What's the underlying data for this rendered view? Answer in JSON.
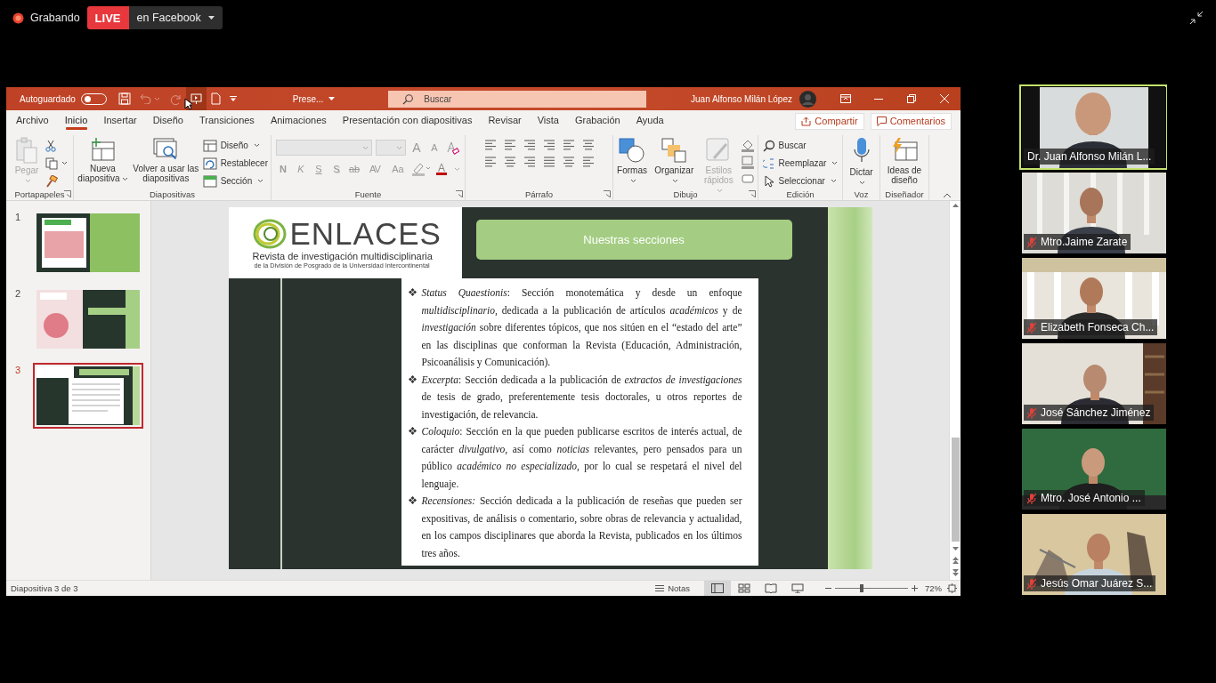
{
  "recording": {
    "status": "Grabando",
    "badge": "LIVE",
    "destination": "en Facebook"
  },
  "app": {
    "title_bar": {
      "autosave_label": "Autoguardado",
      "autosave_on": false,
      "file_name": "Prese...",
      "search_placeholder": "Buscar",
      "user_name": "Juan Alfonso Milán López"
    },
    "tabs": [
      {
        "label": "Archivo",
        "selected": false
      },
      {
        "label": "Inicio",
        "selected": true
      },
      {
        "label": "Insertar",
        "selected": false
      },
      {
        "label": "Diseño",
        "selected": false
      },
      {
        "label": "Transiciones",
        "selected": false
      },
      {
        "label": "Animaciones",
        "selected": false
      },
      {
        "label": "Presentación con diapositivas",
        "selected": false
      },
      {
        "label": "Revisar",
        "selected": false
      },
      {
        "label": "Vista",
        "selected": false
      },
      {
        "label": "Grabación",
        "selected": false
      },
      {
        "label": "Ayuda",
        "selected": false
      }
    ],
    "share_button": "Compartir",
    "comments_button": "Comentarios",
    "ribbon_groups": [
      {
        "name": "Portapapeles",
        "commands": [
          {
            "kind": "large",
            "label": "Pegar",
            "disabled": true
          }
        ]
      },
      {
        "name": "Diapositivas",
        "commands": [
          {
            "kind": "large",
            "label": "Nueva diapositiva",
            "disabled": false
          },
          {
            "kind": "large",
            "label": "Volver a usar las diapositivas",
            "disabled": false
          },
          {
            "kind": "small",
            "label": "Diseño",
            "disabled": false
          },
          {
            "kind": "small",
            "label": "Restablecer",
            "disabled": false
          },
          {
            "kind": "small",
            "label": "Sección",
            "disabled": false
          }
        ]
      },
      {
        "name": "Fuente",
        "size_buttons": [
          "A",
          "A"
        ],
        "format_buttons": [
          "N",
          "K",
          "S",
          "S",
          "ab",
          "AV",
          "Aa"
        ],
        "font_color_button": "A"
      },
      {
        "name": "Párrafo"
      },
      {
        "name": "Dibujo",
        "commands": [
          {
            "kind": "large",
            "label": "Formas",
            "disabled": false
          },
          {
            "kind": "large",
            "label": "Organizar",
            "disabled": false
          },
          {
            "kind": "large",
            "label": "Estilos rápidos",
            "disabled": true
          }
        ]
      },
      {
        "name": "Edición",
        "commands": [
          {
            "kind": "small",
            "label": "Buscar",
            "disabled": false
          },
          {
            "kind": "small",
            "label": "Reemplazar",
            "disabled": false
          },
          {
            "kind": "small",
            "label": "Seleccionar",
            "disabled": false
          }
        ]
      },
      {
        "name": "Voz",
        "commands": [
          {
            "kind": "large",
            "label": "Dictar",
            "disabled": false
          }
        ]
      },
      {
        "name": "Diseñador",
        "commands": [
          {
            "kind": "large",
            "label": "Ideas de diseño",
            "disabled": false
          }
        ]
      }
    ],
    "slides": [
      {
        "number": "1",
        "selected": false
      },
      {
        "number": "2",
        "selected": false
      },
      {
        "number": "3",
        "selected": true
      }
    ],
    "slide": {
      "logo_title": "ENLACES",
      "logo_subtitle": "Revista de investigación multidisciplinaria",
      "logo_tagline": "de la División de Posgrado de la Universidad Intercontinental",
      "heading": "Nuestras secciones",
      "paragraphs": [
        "*Status Quaestionis*: Sección monotemática y desde un enfoque *multidisciplinario*, dedicada a la publicación de artículos *académicos* y de *investigación* sobre diferentes tópicos, que nos sitúen en el “estado del arte” en las disciplinas que conforman la Revista (Educación, Administración, Psicoanálisis y Comunicación).",
        "*Excerpta*: Sección dedicada a la publicación de *extractos de investigaciones* de tesis de grado, preferentemente tesis doctorales, u otros reportes de investigación, de relevancia.",
        "*Coloquio*: Sección en la que pueden publicarse escritos de interés actual, de carácter *divulgativo*, así como *noticias* relevantes, pero pensados para un público *académico no especializado*, por lo cual se respetará el nivel del lenguaje.",
        "*Recensiones:* Sección dedicada a la publicación de reseñas que pueden ser expositivas, de análisis o comentario, sobre obras de relevancia y actualidad, en los campos disciplinares que aborda la Revista, publicados en los últimos tres años."
      ]
    },
    "status_bar": {
      "slide_counter": "Diapositiva 3 de 3",
      "notes_button": "Notas",
      "views": [
        {
          "selected": true
        },
        {
          "selected": false
        },
        {
          "selected": false
        },
        {
          "selected": false
        }
      ],
      "zoom": {
        "level": 0.36,
        "reading": "72%"
      }
    }
  },
  "participants": [
    {
      "name": "Dr. Juan Alfonso Milán L...",
      "speaking": true,
      "muted": false
    },
    {
      "name": "Mtro.Jaime Zarate",
      "speaking": false,
      "muted": true
    },
    {
      "name": "Elizabeth Fonseca Ch...",
      "speaking": false,
      "muted": true
    },
    {
      "name": "José Sánchez Jiménez",
      "speaking": false,
      "muted": true
    },
    {
      "name": "Mtro. José Antonio ...",
      "speaking": false,
      "muted": true
    },
    {
      "name": "Jesús Omar Juárez S...",
      "speaking": false,
      "muted": true
    }
  ]
}
